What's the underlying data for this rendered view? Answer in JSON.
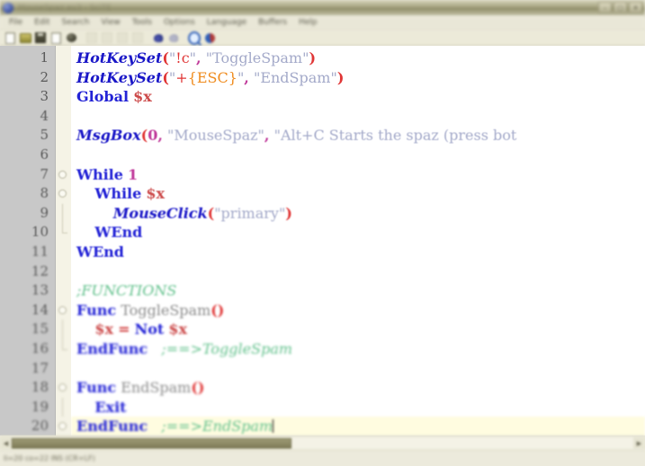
{
  "window": {
    "title": "MouseSpaz.au3 - SciTE",
    "app_icon": "autoit-icon",
    "buttons": [
      {
        "name": "minimize-button",
        "glyph": "–"
      },
      {
        "name": "maximize-button",
        "glyph": "□"
      },
      {
        "name": "close-button",
        "glyph": "✕"
      }
    ]
  },
  "menubar": {
    "items": [
      {
        "label": "File"
      },
      {
        "label": "Edit"
      },
      {
        "label": "Search"
      },
      {
        "label": "View"
      },
      {
        "label": "Tools"
      },
      {
        "label": "Options"
      },
      {
        "label": "Language"
      },
      {
        "label": "Buffers"
      },
      {
        "label": "Help"
      }
    ]
  },
  "toolbar": {
    "items": [
      {
        "name": "new-file-icon",
        "kind": "page",
        "enabled": true
      },
      {
        "name": "open-file-icon",
        "kind": "folder",
        "enabled": true
      },
      {
        "name": "save-file-icon",
        "kind": "floppy",
        "enabled": true
      },
      {
        "name": "save-as-icon",
        "kind": "page",
        "enabled": true
      },
      {
        "name": "print-icon",
        "kind": "print",
        "enabled": true
      },
      {
        "name": "cut-icon",
        "kind": "dim",
        "enabled": false
      },
      {
        "name": "copy-icon",
        "kind": "dim",
        "enabled": false
      },
      {
        "name": "paste-icon",
        "kind": "dim",
        "enabled": false
      },
      {
        "name": "delete-icon",
        "kind": "dim",
        "enabled": false
      },
      {
        "name": "undo-icon",
        "kind": "undo",
        "enabled": true
      },
      {
        "name": "redo-icon",
        "kind": "redo",
        "enabled": false
      },
      {
        "name": "find-icon",
        "kind": "find",
        "enabled": true
      },
      {
        "name": "replace-icon",
        "kind": "replace",
        "enabled": true
      }
    ]
  },
  "editor": {
    "language": "AutoIt",
    "current_line": 20,
    "line_numbers": [
      1,
      2,
      3,
      4,
      5,
      6,
      7,
      8,
      9,
      10,
      11,
      12,
      13,
      14,
      15,
      16,
      17,
      18,
      19,
      20
    ],
    "fold_markers": [
      {
        "line": 7,
        "type": "open"
      },
      {
        "line": 8,
        "type": "open"
      },
      {
        "line": 9,
        "type": "bar"
      },
      {
        "line": 10,
        "type": "tail"
      },
      {
        "line": 14,
        "type": "open"
      },
      {
        "line": 15,
        "type": "bar"
      },
      {
        "line": 16,
        "type": "tail"
      },
      {
        "line": 18,
        "type": "open"
      },
      {
        "line": 19,
        "type": "bar"
      },
      {
        "line": 20,
        "type": "open"
      }
    ],
    "lines": [
      {
        "n": 1,
        "tokens": [
          {
            "t": "fn",
            "v": "HotKeySet"
          },
          {
            "t": "par",
            "v": "("
          },
          {
            "t": "str",
            "v": "\""
          },
          {
            "t": "hot",
            "v": "!c"
          },
          {
            "t": "str",
            "v": "\""
          },
          {
            "t": "comma",
            "v": ","
          },
          {
            "t": "str",
            "v": " \"ToggleSpam\""
          },
          {
            "t": "par",
            "v": ")"
          }
        ]
      },
      {
        "n": 2,
        "tokens": [
          {
            "t": "fn",
            "v": "HotKeySet"
          },
          {
            "t": "par",
            "v": "("
          },
          {
            "t": "str",
            "v": "\""
          },
          {
            "t": "hot",
            "v": "+"
          },
          {
            "t": "hot2",
            "v": "{ESC}"
          },
          {
            "t": "str",
            "v": "\""
          },
          {
            "t": "comma",
            "v": ","
          },
          {
            "t": "str",
            "v": " \"EndSpam\""
          },
          {
            "t": "par",
            "v": ")"
          }
        ]
      },
      {
        "n": 3,
        "tokens": [
          {
            "t": "kw",
            "v": "Global"
          },
          {
            "t": "plain",
            "v": " "
          },
          {
            "t": "var",
            "v": "$x"
          }
        ]
      },
      {
        "n": 4,
        "tokens": []
      },
      {
        "n": 5,
        "tokens": [
          {
            "t": "fn",
            "v": "MsgBox"
          },
          {
            "t": "par",
            "v": "("
          },
          {
            "t": "num",
            "v": "0"
          },
          {
            "t": "comma",
            "v": ","
          },
          {
            "t": "str",
            "v": " \"MouseSpaz\""
          },
          {
            "t": "comma",
            "v": ","
          },
          {
            "t": "str",
            "v": " \"Alt+C Starts the spaz (press bot"
          }
        ]
      },
      {
        "n": 6,
        "tokens": []
      },
      {
        "n": 7,
        "tokens": [
          {
            "t": "kw",
            "v": "While"
          },
          {
            "t": "plain",
            "v": " "
          },
          {
            "t": "num",
            "v": "1"
          }
        ]
      },
      {
        "n": 8,
        "tokens": [
          {
            "t": "plain",
            "v": "    "
          },
          {
            "t": "kw",
            "v": "While"
          },
          {
            "t": "plain",
            "v": " "
          },
          {
            "t": "var",
            "v": "$x"
          }
        ]
      },
      {
        "n": 9,
        "tokens": [
          {
            "t": "plain",
            "v": "        "
          },
          {
            "t": "fn",
            "v": "MouseClick"
          },
          {
            "t": "par",
            "v": "("
          },
          {
            "t": "str",
            "v": "\"primary\""
          },
          {
            "t": "par",
            "v": ")"
          }
        ]
      },
      {
        "n": 10,
        "tokens": [
          {
            "t": "plain",
            "v": "    "
          },
          {
            "t": "kw",
            "v": "WEnd"
          }
        ]
      },
      {
        "n": 11,
        "tokens": [
          {
            "t": "kw",
            "v": "WEnd"
          }
        ]
      },
      {
        "n": 12,
        "tokens": []
      },
      {
        "n": 13,
        "tokens": [
          {
            "t": "cmt",
            "v": ";FUNCTIONS"
          }
        ]
      },
      {
        "n": 14,
        "tokens": [
          {
            "t": "kw",
            "v": "Func"
          },
          {
            "t": "plain",
            "v": " "
          },
          {
            "t": "ident",
            "v": "ToggleSpam"
          },
          {
            "t": "par",
            "v": "()"
          }
        ]
      },
      {
        "n": 15,
        "tokens": [
          {
            "t": "plain",
            "v": "    "
          },
          {
            "t": "var",
            "v": "$x"
          },
          {
            "t": "plain",
            "v": " "
          },
          {
            "t": "op",
            "v": "="
          },
          {
            "t": "plain",
            "v": " "
          },
          {
            "t": "kw",
            "v": "Not"
          },
          {
            "t": "plain",
            "v": " "
          },
          {
            "t": "var",
            "v": "$x"
          }
        ]
      },
      {
        "n": 16,
        "tokens": [
          {
            "t": "kw",
            "v": "EndFunc"
          },
          {
            "t": "plain",
            "v": "   "
          },
          {
            "t": "cmt",
            "v": ";==>ToggleSpam"
          }
        ]
      },
      {
        "n": 17,
        "tokens": []
      },
      {
        "n": 18,
        "tokens": [
          {
            "t": "kw",
            "v": "Func"
          },
          {
            "t": "plain",
            "v": " "
          },
          {
            "t": "ident",
            "v": "EndSpam"
          },
          {
            "t": "par",
            "v": "()"
          }
        ]
      },
      {
        "n": 19,
        "tokens": [
          {
            "t": "plain",
            "v": "    "
          },
          {
            "t": "kw",
            "v": "Exit"
          }
        ]
      },
      {
        "n": 20,
        "tokens": [
          {
            "t": "kw",
            "v": "EndFunc"
          },
          {
            "t": "plain",
            "v": "   "
          },
          {
            "t": "cmt",
            "v": ";==>EndSpam"
          }
        ],
        "caret": true
      }
    ]
  },
  "hscrollbar": {
    "left_arrow": "◀",
    "right_arrow": "▶",
    "thumb_width_pct": 45
  },
  "statusbar": {
    "text": "li=20 co=22 INS (CR+LF)"
  },
  "colors": {
    "titlebar": "#8e8c66",
    "chrome": "#eceadc",
    "gutter": "#c8c8c8",
    "fold_margin": "#f5f3e6",
    "editor_bg": "#ffffff",
    "current_line": "#fffce0",
    "function": "#1a17c7",
    "keyword": "#2323d6",
    "string": "#a3a9c9",
    "comment": "#5fc08a",
    "variable": "#cc4a4a",
    "number": "#c0399a",
    "paren": "#e03636",
    "hotkey": "#e03636",
    "hotkey_special": "#ef8b1d",
    "identifier": "#8a8a8a",
    "scroll_thumb": "#8b8862"
  }
}
